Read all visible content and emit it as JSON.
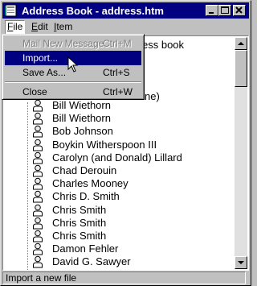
{
  "window": {
    "title": "Address Book - address.htm"
  },
  "menubar": {
    "items": [
      "File",
      "Edit",
      "Item"
    ]
  },
  "file_menu": {
    "items": [
      {
        "label": "Mail New Message",
        "shortcut": "Ctrl+M",
        "state": "disabled"
      },
      {
        "label": "Import...",
        "shortcut": "",
        "state": "selected"
      },
      {
        "label": "Save As...",
        "shortcut": "Ctrl+S",
        "state": "normal"
      },
      {
        "label": "Close",
        "shortcut": "Ctrl+W",
        "state": "normal"
      }
    ]
  },
  "content": {
    "heading_partial": "ess book",
    "partial_entry": "ne)",
    "contacts": [
      "Bill Wiethorn",
      "Bill Wiethorn",
      "Bob Johnson",
      "Boykin Witherspoon III",
      "Carolyn (and Donald) Lillard",
      "Chad Derouin",
      "Charles Mooney",
      "Chris D. Smith",
      "Chris Smith",
      "Chris Smith",
      "Chris Smith",
      "Damon Fehler",
      "David G. Sawyer"
    ]
  },
  "statusbar": {
    "text": "Import a new file"
  },
  "colors": {
    "titlebar": "#000080",
    "selection": "#000080",
    "chrome": "#c0c0c0"
  }
}
